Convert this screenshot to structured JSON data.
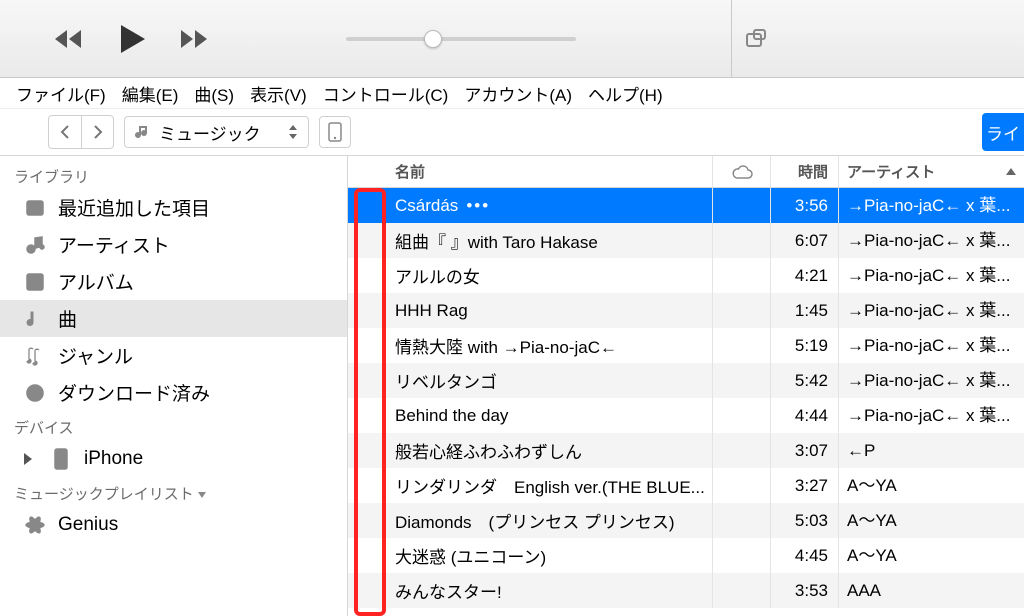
{
  "menu": [
    "ファイル(F)",
    "編集(E)",
    "曲(S)",
    "表示(V)",
    "コントロール(C)",
    "アカウント(A)",
    "ヘルプ(H)"
  ],
  "toolbar": {
    "media_type": "ミュージック",
    "blue_right_label": "ライ"
  },
  "sidebar": {
    "library_header": "ライブラリ",
    "library_items": [
      {
        "name": "recently-added",
        "label": "最近追加した項目"
      },
      {
        "name": "artists",
        "label": "アーティスト"
      },
      {
        "name": "albums",
        "label": "アルバム"
      },
      {
        "name": "songs",
        "label": "曲",
        "selected": true
      },
      {
        "name": "genres",
        "label": "ジャンル"
      },
      {
        "name": "downloaded",
        "label": "ダウンロード済み"
      }
    ],
    "devices_header": "デバイス",
    "devices": [
      {
        "name": "iphone",
        "label": "iPhone"
      }
    ],
    "playlists_header": "ミュージックプレイリスト",
    "playlists": [
      {
        "name": "genius",
        "label": "Genius"
      }
    ]
  },
  "columns": {
    "name": "名前",
    "time": "時間",
    "artist": "アーティスト"
  },
  "tracks": [
    {
      "name": "Csárdás",
      "time": "3:56",
      "artist": "→Pia-no-jaC← x 葉...",
      "selected": true,
      "dots": true
    },
    {
      "name": "組曲『 』with Taro Hakase",
      "time": "6:07",
      "artist": "→Pia-no-jaC← x 葉..."
    },
    {
      "name": "アルルの女",
      "time": "4:21",
      "artist": "→Pia-no-jaC← x 葉..."
    },
    {
      "name": "HHH Rag",
      "time": "1:45",
      "artist": "→Pia-no-jaC← x 葉..."
    },
    {
      "name": "情熱大陸 with →Pia-no-jaC←",
      "time": "5:19",
      "artist": "→Pia-no-jaC← x 葉..."
    },
    {
      "name": "リベルタンゴ",
      "time": "5:42",
      "artist": "→Pia-no-jaC← x 葉..."
    },
    {
      "name": "Behind the day",
      "time": "4:44",
      "artist": "→Pia-no-jaC← x 葉..."
    },
    {
      "name": "般若心経ふわふわずしん",
      "time": "3:07",
      "artist": "←P"
    },
    {
      "name": "リンダリンダ　English ver.(THE BLUE...",
      "time": "3:27",
      "artist": "A～YA"
    },
    {
      "name": "Diamonds　(プリンセス プリンセス)",
      "time": "5:03",
      "artist": "A～YA"
    },
    {
      "name": "大迷惑 (ユニコーン)",
      "time": "4:45",
      "artist": "A～YA"
    },
    {
      "name": "みんなスター!",
      "time": "3:53",
      "artist": "AAA"
    }
  ]
}
